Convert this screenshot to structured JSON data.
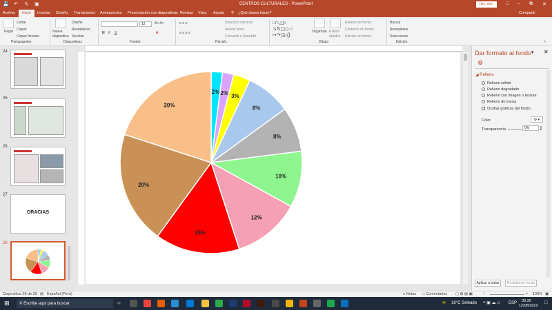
{
  "window": {
    "title": "CENTROS CULTURALES  -  PowerPoint",
    "signin": "Inic. ses.",
    "share": "Compartir"
  },
  "tabs": [
    "Archivo",
    "Inicio",
    "Insertar",
    "Diseño",
    "Transiciones",
    "Animaciones",
    "Presentación con diapositivas",
    "Revisar",
    "Vista",
    "Ayuda",
    "¿Qué desea hacer?"
  ],
  "ribbon": {
    "clipboard": {
      "paste": "Pegar",
      "cut": "Cortar",
      "copy": "Copiar",
      "format": "Copiar formato",
      "group": "Portapapeles"
    },
    "slides": {
      "new": "Nueva diapositiva",
      "layout": "Diseño",
      "reset": "Restablecer",
      "section": "Sección",
      "group": "Diapositivas"
    },
    "font": {
      "size": "12",
      "group": "Fuente"
    },
    "paragraph": {
      "direction": "Dirección del texto",
      "align": "Alinear texto",
      "smartart": "Convertir a SmartArt",
      "group": "Párrafo"
    },
    "drawing": {
      "arrange": "Organizar",
      "quick": "Estilos rápidos",
      "fill": "Relleno de forma",
      "outline": "Contorno de forma",
      "effects": "Efectos de forma",
      "group": "Dibujo"
    },
    "editing": {
      "find": "Buscar",
      "replace": "Reemplazar",
      "select": "Seleccionar",
      "group": "Edición"
    }
  },
  "thumbnails": [
    {
      "num": "24",
      "label": ""
    },
    {
      "num": "25",
      "label": ""
    },
    {
      "num": "26",
      "label": ""
    },
    {
      "num": "27",
      "label": "GRACIAS"
    },
    {
      "num": "28",
      "label": ""
    }
  ],
  "chart_data": {
    "type": "pie",
    "values": [
      2,
      2,
      3,
      8,
      8,
      10,
      12,
      15,
      20,
      20
    ],
    "labels": [
      "2%",
      "2%",
      "3%",
      "8%",
      "8%",
      "10%",
      "12%",
      "15%",
      "20%",
      "20%"
    ],
    "colors": [
      "#00e5ff",
      "#d9a3ff",
      "#ffff00",
      "#a9c8ee",
      "#b3b3b3",
      "#8ff58f",
      "#f5a0b4",
      "#ff0000",
      "#c99155",
      "#f9bf88"
    ]
  },
  "pane": {
    "title": "Dar formato al fondo",
    "section": "Relleno",
    "options": [
      "Relleno sólido",
      "Relleno degradado",
      "Relleno con imagen o textura",
      "Relleno de trama"
    ],
    "hide": "Ocultar gráficos del fondo",
    "color_label": "Color",
    "transparency_label": "Transparencia",
    "transparency_value": "0%",
    "apply_all": "Aplicar a todas",
    "reset": "Restablecer fondo"
  },
  "status": {
    "slide": "Diapositiva 28 de 28",
    "language": "Español (Perú)",
    "notes": "Notas",
    "comments": "Comentarios",
    "zoom": "130%"
  },
  "taskbar": {
    "search": "Escribe aquí para buscar",
    "weather": "18°C  Soleado",
    "lang": "ESP",
    "time": "09:30",
    "date": "12/08/2022"
  }
}
